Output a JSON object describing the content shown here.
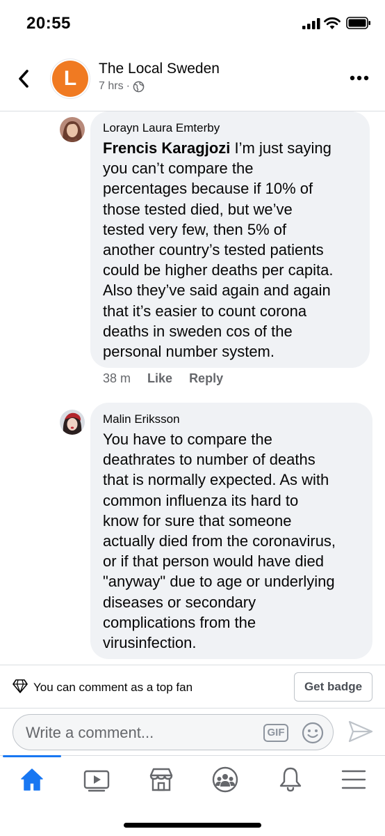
{
  "status_bar": {
    "time": "20:55"
  },
  "header": {
    "page_name": "The Local Sweden",
    "avatar_letter": "L",
    "post_age": "7 hrs",
    "separator": "·"
  },
  "comments": [
    {
      "author": "Lorayn Laura Emterby",
      "mention": "Frencis Karagjozi",
      "lines": [
        "I’m just saying",
        "you can’t compare the",
        "percentages because if 10% of",
        "those tested died, but we’ve",
        "tested very few, then 5% of",
        "another country’s tested patients",
        "could be higher deaths per capita.",
        "Also they’ve said again and again",
        "that it’s easier to count corona",
        "deaths in sweden cos of the",
        "personal number system."
      ],
      "time": "38 m",
      "like_label": "Like",
      "reply_label": "Reply"
    },
    {
      "author": "Malin Eriksson",
      "lines": [
        "You have to compare the",
        "deathrates to number of deaths",
        "that is normally expected. As with",
        "common influenza its hard to",
        "know for sure that someone",
        "actually died from the coronavirus,",
        "or if that person would have died",
        "\"anyway\" due to age or underlying",
        "diseases or secondary",
        "complications from the",
        "virusinfection."
      ]
    }
  ],
  "top_fan": {
    "text": "You can comment as a top fan",
    "button_label": "Get badge"
  },
  "composer": {
    "placeholder": "Write a comment...",
    "gif_label": "GIF"
  },
  "nav": {
    "active": "home",
    "accent_color": "#1877f2",
    "items": [
      "home-icon",
      "watch-icon",
      "marketplace-icon",
      "groups-icon",
      "notifications-icon",
      "menu-icon"
    ]
  }
}
